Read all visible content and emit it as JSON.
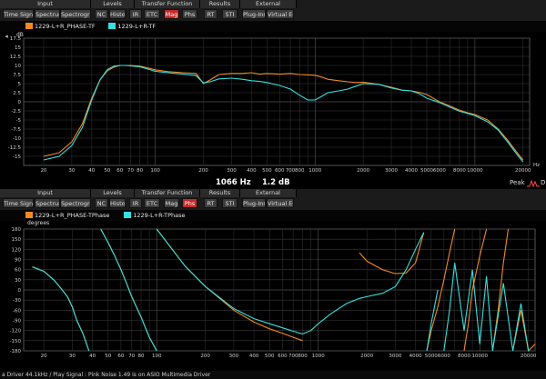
{
  "top_panel": {
    "toolbar": {
      "groups": [
        {
          "title": "Input",
          "x": 0,
          "w": 100
        },
        {
          "title": "Levels",
          "x": 100,
          "w": 48
        },
        {
          "title": "Transfer Function",
          "x": 148,
          "w": 72
        },
        {
          "title": "Results",
          "x": 220,
          "w": 44
        },
        {
          "title": "External",
          "x": 264,
          "w": 62
        }
      ],
      "buttons": [
        {
          "label": "Time Signal",
          "x": 3,
          "w": 34,
          "active": false
        },
        {
          "label": "Spectrum",
          "x": 38,
          "w": 28,
          "active": false
        },
        {
          "label": "Spectrogram",
          "x": 66,
          "w": 34,
          "active": false
        },
        {
          "label": "NC",
          "x": 104,
          "w": 15,
          "active": false
        },
        {
          "label": "Histo",
          "x": 120,
          "w": 18,
          "active": false
        },
        {
          "label": "IR",
          "x": 142,
          "w": 14,
          "active": false
        },
        {
          "label": "ETC",
          "x": 158,
          "w": 18,
          "active": false
        },
        {
          "label": "Mag",
          "x": 180,
          "w": 17,
          "active": true
        },
        {
          "label": "Phs",
          "x": 200,
          "w": 17,
          "active": false
        },
        {
          "label": "RT",
          "x": 224,
          "w": 15,
          "active": false
        },
        {
          "label": "STI",
          "x": 244,
          "w": 17,
          "active": false
        },
        {
          "label": "Plug-Ins",
          "x": 266,
          "w": 26,
          "active": false
        },
        {
          "label": "Virtual EQ",
          "x": 293,
          "w": 30,
          "active": false
        }
      ]
    },
    "legend": [
      {
        "label": "1229-L+R_PHASE-TF",
        "color": "#f08a24"
      },
      {
        "label": "1229-L+R-TF",
        "color": "#35e0e0"
      }
    ],
    "y_unit": "dB",
    "y_ticks": [
      "17.5",
      "15",
      "12.5",
      "10",
      "7.5",
      "5",
      "2.5",
      "0",
      "-2.5",
      "-5",
      "-7.5",
      "-10",
      "-12.5",
      "-15"
    ],
    "x_unit": "Hz",
    "x_ticks": [
      "20",
      "30",
      "40",
      "50",
      "60",
      "70",
      "80",
      "100",
      "200",
      "300",
      "400",
      "500",
      "600",
      "700",
      "800",
      "1000",
      "2000",
      "3000",
      "4000",
      "5000",
      "6000",
      "8000",
      "10000",
      "20000"
    ]
  },
  "readout": {
    "freq": "1066 Hz",
    "value": "1.2 dB",
    "peak_label": "Peak",
    "suffix": "D"
  },
  "bottom_panel": {
    "toolbar": {
      "groups": [
        {
          "title": "Input",
          "x": 0,
          "w": 100
        },
        {
          "title": "Levels",
          "x": 100,
          "w": 48
        },
        {
          "title": "Transfer Function",
          "x": 148,
          "w": 72
        },
        {
          "title": "Results",
          "x": 220,
          "w": 44
        },
        {
          "title": "External",
          "x": 264,
          "w": 62
        }
      ],
      "buttons": [
        {
          "label": "Time Signal",
          "x": 3,
          "w": 34,
          "active": false
        },
        {
          "label": "Spectrum",
          "x": 38,
          "w": 28,
          "active": false
        },
        {
          "label": "Spectrogram",
          "x": 66,
          "w": 34,
          "active": false
        },
        {
          "label": "NC",
          "x": 104,
          "w": 15,
          "active": false
        },
        {
          "label": "Histo",
          "x": 120,
          "w": 18,
          "active": false
        },
        {
          "label": "IR",
          "x": 142,
          "w": 14,
          "active": false
        },
        {
          "label": "ETC",
          "x": 158,
          "w": 18,
          "active": false
        },
        {
          "label": "Mag",
          "x": 180,
          "w": 17,
          "active": false
        },
        {
          "label": "Phs",
          "x": 200,
          "w": 17,
          "active": true
        },
        {
          "label": "RT",
          "x": 224,
          "w": 15,
          "active": false
        },
        {
          "label": "STI",
          "x": 244,
          "w": 17,
          "active": false
        },
        {
          "label": "Plug-Ins",
          "x": 266,
          "w": 26,
          "active": false
        },
        {
          "label": "Virtual EQ",
          "x": 293,
          "w": 30,
          "active": false
        }
      ]
    },
    "legend": [
      {
        "label": "1229-L+R_PHASE-TPhase",
        "color": "#f08a24"
      },
      {
        "label": "1229-L+R-TPhase",
        "color": "#35e0e0"
      }
    ],
    "y_unit": "degrees",
    "y_ticks": [
      "180",
      "150",
      "120",
      "90",
      "60",
      "30",
      "0",
      "-30",
      "-60",
      "-90",
      "-120",
      "-150",
      "-180"
    ],
    "x_ticks": [
      "20",
      "30",
      "40",
      "50",
      "60",
      "70",
      "80",
      "100",
      "200",
      "300",
      "400",
      "500",
      "600",
      "700",
      "800",
      "1000",
      "2000",
      "3000",
      "4000",
      "5000",
      "6000",
      "8000",
      "10000",
      "20000"
    ]
  },
  "status_bar": "a Driver 44.1kHz / Play Signal : Pink Noise  1.49 is on ASIO Multimedia Driver",
  "chart_data": [
    {
      "type": "line",
      "title": "",
      "xlabel": "Hz",
      "ylabel": "dB",
      "xscale": "log",
      "xlim": [
        15,
        22000
      ],
      "ylim": [
        -17.5,
        17.5
      ],
      "grid": true,
      "legend_position": "top-left",
      "series": [
        {
          "name": "1229-L+R_PHASE-TF",
          "color": "#f08a24",
          "x": [
            20,
            25,
            30,
            35,
            40,
            45,
            50,
            55,
            60,
            65,
            70,
            80,
            90,
            100,
            120,
            150,
            180,
            200,
            220,
            250,
            300,
            350,
            400,
            450,
            500,
            600,
            700,
            800,
            900,
            1000,
            1100,
            1200,
            1400,
            1600,
            1800,
            2000,
            2500,
            3000,
            3500,
            4000,
            4500,
            5000,
            6000,
            7000,
            8000,
            9000,
            10000,
            12000,
            14000,
            16000,
            18000,
            20000
          ],
          "y": [
            -15,
            -14,
            -11,
            -6,
            1,
            6,
            8.5,
            9.5,
            10,
            10,
            10,
            9.8,
            9.3,
            8.8,
            8.3,
            8,
            7.8,
            5,
            6,
            7.5,
            7.8,
            7.8,
            8,
            7.6,
            7.8,
            7.6,
            7.8,
            7.5,
            7.4,
            7.3,
            6.8,
            6.2,
            5.8,
            5.5,
            5.3,
            5.4,
            4.8,
            4,
            3.2,
            3,
            2.6,
            2,
            0,
            -1.2,
            -2.3,
            -3,
            -3.5,
            -5,
            -7.5,
            -10.5,
            -13.5,
            -16
          ]
        },
        {
          "name": "1229-L+R-TF",
          "color": "#35e0e0",
          "x": [
            20,
            25,
            30,
            35,
            40,
            45,
            50,
            55,
            60,
            65,
            70,
            80,
            90,
            100,
            120,
            150,
            180,
            200,
            220,
            250,
            300,
            350,
            400,
            450,
            500,
            600,
            700,
            800,
            900,
            1000,
            1100,
            1200,
            1400,
            1600,
            1800,
            2000,
            2500,
            3000,
            3500,
            4000,
            4500,
            5000,
            6000,
            7000,
            8000,
            9000,
            10000,
            12000,
            14000,
            16000,
            18000,
            20000
          ],
          "y": [
            -16,
            -15,
            -12,
            -7,
            0.5,
            6,
            8.8,
            9.8,
            10,
            10,
            9.9,
            9.6,
            9,
            8.4,
            8,
            7.6,
            7.2,
            5.2,
            5.5,
            6.3,
            6.5,
            6.2,
            5.8,
            5.6,
            5.3,
            4.5,
            3.5,
            1.8,
            0.5,
            0.5,
            1.5,
            2.5,
            3,
            3.5,
            4.3,
            5,
            4.8,
            3.8,
            3.2,
            3,
            2.2,
            1,
            -0.2,
            -1.5,
            -2.6,
            -3.2,
            -3.8,
            -5.5,
            -7.8,
            -11,
            -14,
            -16.5
          ]
        }
      ]
    },
    {
      "type": "line",
      "title": "",
      "xlabel": "",
      "ylabel": "degrees",
      "xscale": "log",
      "xlim": [
        15,
        22000
      ],
      "ylim": [
        -180,
        180
      ],
      "grid": true,
      "legend_position": "top-left",
      "series": [
        {
          "name": "1229-L+R_PHASE-TPhase",
          "color": "#f08a24",
          "x": [
            15,
            17,
            20,
            23,
            25,
            28,
            30,
            32,
            35,
            38,
            42,
            45,
            50,
            55,
            60,
            65,
            70,
            80,
            90,
            100,
            100,
            120,
            150,
            200,
            300,
            400,
            500,
            600,
            700,
            800,
            800,
            900,
            1000,
            1200,
            1500,
            1500,
            1800,
            2000,
            2500,
            3000,
            3500,
            4000,
            4500,
            4600,
            4700,
            5000,
            5500,
            6000,
            6500,
            7000,
            8000,
            8500,
            9000,
            10000,
            11000,
            12000,
            13000,
            14000,
            15000,
            16000,
            18000,
            20000,
            22000
          ],
          "y": [
            null,
            68,
            55,
            30,
            10,
            -20,
            -50,
            -90,
            -130,
            -180,
            null,
            180,
            140,
            100,
            60,
            20,
            -20,
            -80,
            -140,
            -180,
            180,
            130,
            70,
            10,
            -60,
            -95,
            -115,
            -128,
            -140,
            -150,
            null,
            null,
            null,
            null,
            180,
            null,
            110,
            85,
            60,
            48,
            50,
            80,
            170,
            null,
            -180,
            -120,
            -50,
            30,
            110,
            180,
            -180,
            -100,
            0,
            100,
            180,
            -180,
            -60,
            80,
            180,
            -180,
            -60,
            -180,
            -160
          ]
        },
        {
          "name": "1229-L+R-TPhase",
          "color": "#35e0e0",
          "x": [
            15,
            17,
            20,
            23,
            25,
            28,
            30,
            32,
            35,
            38,
            42,
            45,
            50,
            55,
            60,
            65,
            70,
            80,
            90,
            100,
            100,
            120,
            150,
            200,
            300,
            400,
            500,
            600,
            700,
            800,
            900,
            1000,
            1200,
            1500,
            1800,
            2000,
            2500,
            3000,
            3500,
            4000,
            4500,
            4600,
            4700,
            5000,
            5500,
            5500,
            6000,
            6500,
            7000,
            8000,
            9000,
            10000,
            11000,
            12000,
            14000,
            16000,
            18000,
            20000
          ],
          "y": [
            null,
            68,
            55,
            30,
            10,
            -20,
            -50,
            -90,
            -130,
            -180,
            null,
            180,
            140,
            100,
            60,
            20,
            -20,
            -80,
            -140,
            -180,
            180,
            130,
            70,
            10,
            -55,
            -85,
            -100,
            -112,
            -122,
            -130,
            -120,
            -100,
            -70,
            -40,
            -25,
            -20,
            -10,
            10,
            60,
            120,
            170,
            null,
            -180,
            -100,
            0,
            null,
            -180,
            -60,
            80,
            -120,
            60,
            -160,
            40,
            -180,
            20,
            -180,
            -40,
            -180
          ]
        }
      ]
    }
  ]
}
